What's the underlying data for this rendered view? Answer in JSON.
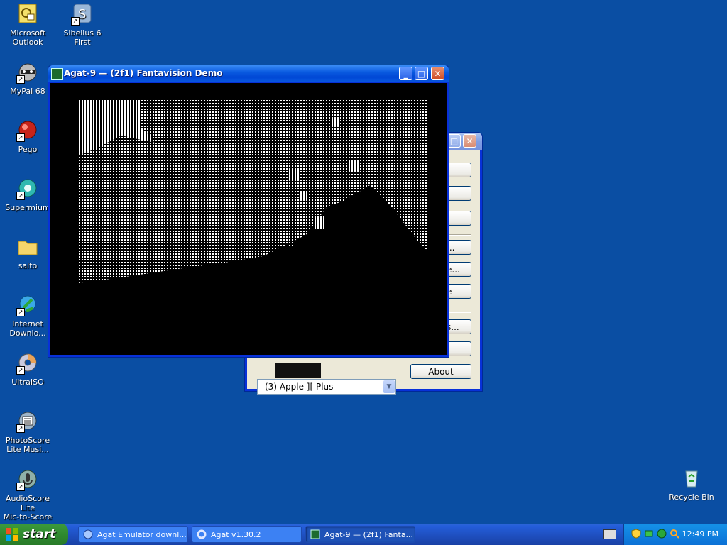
{
  "desktop": {
    "icons": [
      {
        "label": "Microsoft\nOutlook",
        "icon": "outlook-icon"
      },
      {
        "label": "Sibelius 6 First",
        "icon": "sibelius-icon"
      },
      {
        "label": "MyPal 68",
        "icon": "raccoon-browser-icon"
      },
      {
        "label": "Pego",
        "icon": "red-ball-icon"
      },
      {
        "label": "Supermium",
        "icon": "supermium-browser-icon"
      },
      {
        "label": "salto",
        "icon": "folder-icon"
      },
      {
        "label": "Internet\nDownlo...",
        "icon": "download-manager-icon"
      },
      {
        "label": "UltraISO",
        "icon": "disc-icon"
      },
      {
        "label": "PhotoScore\nLite Musi...",
        "icon": "photoscore-icon"
      },
      {
        "label": "AudioScore Lite\nMic-to-Score",
        "icon": "audioscore-icon"
      },
      {
        "label": "Recycle Bin",
        "icon": "recycle-bin-icon"
      }
    ]
  },
  "back_window": {
    "buttons": [
      "",
      "",
      "",
      "...",
      "e...",
      "e",
      "s...",
      "",
      "About"
    ],
    "model_select": {
      "value": "(3) Apple ][ Plus"
    }
  },
  "emu_window": {
    "title": "Agat-9 — (2f1) Fantavision Demo"
  },
  "taskbar": {
    "start_label": "start",
    "tasks": [
      {
        "label": "Agat Emulator downl...",
        "icon": "browser-icon"
      },
      {
        "label": "Agat v1.30.2",
        "icon": "gear-icon"
      },
      {
        "label": "Agat-9 — (2f1) Fanta...",
        "icon": "emulator-icon"
      }
    ],
    "clock": "12:49 PM"
  },
  "colors": {
    "desktop": "#0a4ea3",
    "titlebar": "#0a5ae0",
    "taskbar": "#245edb",
    "start": "#2f8a2f"
  }
}
